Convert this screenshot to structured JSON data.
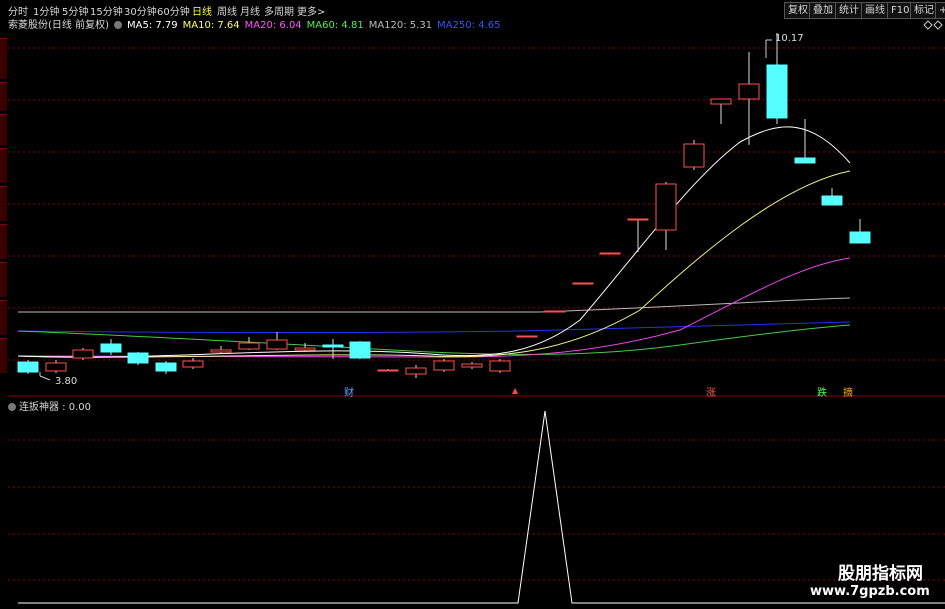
{
  "periods": [
    "分时",
    "1分钟",
    "5分钟",
    "15分钟",
    "30分钟",
    "60分钟",
    "日线",
    "周线",
    "月线",
    "多周期",
    "更多>"
  ],
  "active_period": "日线",
  "right_buttons": [
    "复权",
    "叠加",
    "统计",
    "画线",
    "F10",
    "标记",
    "+"
  ],
  "stock_title": "索菱股份(日线 前复权)",
  "ma": [
    {
      "label": "MA5: 7.79",
      "color": "#ffffff"
    },
    {
      "label": "MA10: 7.64",
      "color": "#ffff66"
    },
    {
      "label": "MA20: 6.04",
      "color": "#ff55ff"
    },
    {
      "label": "MA60: 4.81",
      "color": "#55ee55"
    },
    {
      "label": "MA120: 5.31",
      "color": "#bbbbbb"
    },
    {
      "label": "MA250: 4.65",
      "color": "#3355ff"
    }
  ],
  "high_label": "10.17",
  "low_label": "3.80",
  "event_markers": [
    {
      "text": "财",
      "color": "#55aaff"
    },
    {
      "text": "▲",
      "color": "#ff4444"
    },
    {
      "text": "涨",
      "color": "#ff5555"
    },
    {
      "text": "跌",
      "color": "#55ff55"
    },
    {
      "text": "摘",
      "color": "#ffaa00"
    }
  ],
  "indicator_title": "连扳神器 : 0.00",
  "watermark": {
    "logo": "股朋指标网",
    "url": "www.7gpzb.com"
  },
  "colors": {
    "up": "#ff5050",
    "down": "#55ffff",
    "grid": "#8b0000"
  }
}
